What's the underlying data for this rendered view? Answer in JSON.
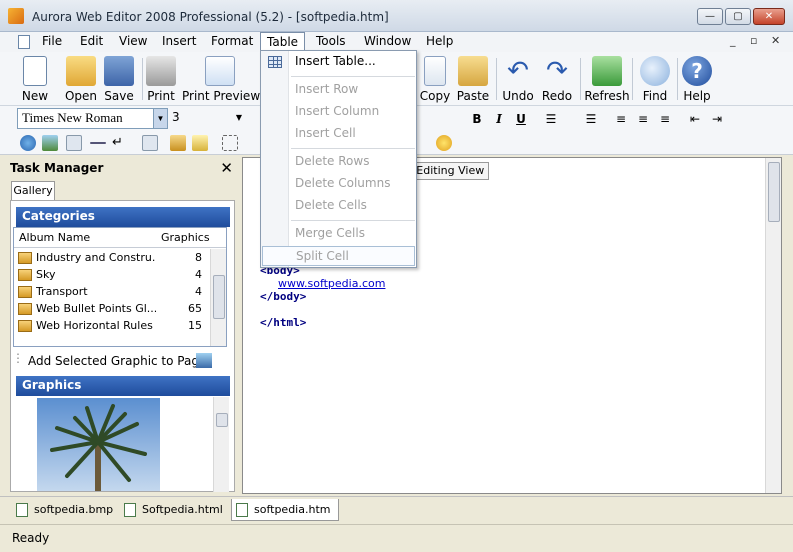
{
  "window": {
    "title": "Aurora Web Editor 2008 Professional (5.2) - [softpedia.htm]",
    "controls": {
      "minimize": "—",
      "maximize": "▢",
      "close": "✕"
    }
  },
  "menubar": {
    "items": [
      "File",
      "Edit",
      "View",
      "Insert",
      "Format",
      "Table",
      "Tools",
      "Window",
      "Help"
    ],
    "active": "Table",
    "mdi_controls": {
      "minimize": "_",
      "restore": "▫",
      "close": "✕"
    }
  },
  "toolbar": {
    "buttons": [
      "New",
      "Open",
      "Save",
      "Print",
      "Print Preview",
      "Copy",
      "Paste",
      "Undo",
      "Redo",
      "Refresh",
      "Find",
      "Help"
    ]
  },
  "format_bar": {
    "font_name": "Times New Roman",
    "font_size": "3",
    "bold": "B",
    "italic": "I",
    "underline": "U"
  },
  "task_manager": {
    "title": "Task Manager",
    "close_glyph": "✕",
    "tab": "Gallery",
    "categories_header": "Categories",
    "columns": {
      "name": "Album Name",
      "count": "Graphics"
    },
    "categories": [
      {
        "name": "Industry and Constru...",
        "count": "8"
      },
      {
        "name": "Sky",
        "count": "4"
      },
      {
        "name": "Transport",
        "count": "4"
      },
      {
        "name": "Web Bullet Points Gl...",
        "count": "65"
      },
      {
        "name": "Web Horizontal Rules",
        "count": "15"
      }
    ],
    "add_selected": "Add Selected Graphic to Page",
    "graphics_header": "Graphics"
  },
  "editor": {
    "tab_label": "al Editing View",
    "code_lines": {
      "body_open": "<body>",
      "link": "www.softpedia.com",
      "body_close": "</body>",
      "html_close": "</html>"
    }
  },
  "table_menu": {
    "items": [
      {
        "label": "Insert Table...",
        "enabled": true
      },
      {
        "label": "Insert Row",
        "enabled": false
      },
      {
        "label": "Insert Column",
        "enabled": false
      },
      {
        "label": "Insert Cell",
        "enabled": false
      },
      {
        "label": "Delete Rows",
        "enabled": false
      },
      {
        "label": "Delete Columns",
        "enabled": false
      },
      {
        "label": "Delete Cells",
        "enabled": false
      },
      {
        "label": "Merge Cells",
        "enabled": false
      },
      {
        "label": "Split Cell",
        "enabled": false,
        "highlighted": true
      }
    ]
  },
  "doc_tabs": [
    "softpedia.bmp",
    "Softpedia.html",
    "softpedia.htm"
  ],
  "active_doc_tab": "softpedia.htm",
  "status": {
    "text": "Ready"
  },
  "colors": {
    "section_header": "#2a5aae",
    "code": "#000080",
    "link": "#0000cc"
  }
}
